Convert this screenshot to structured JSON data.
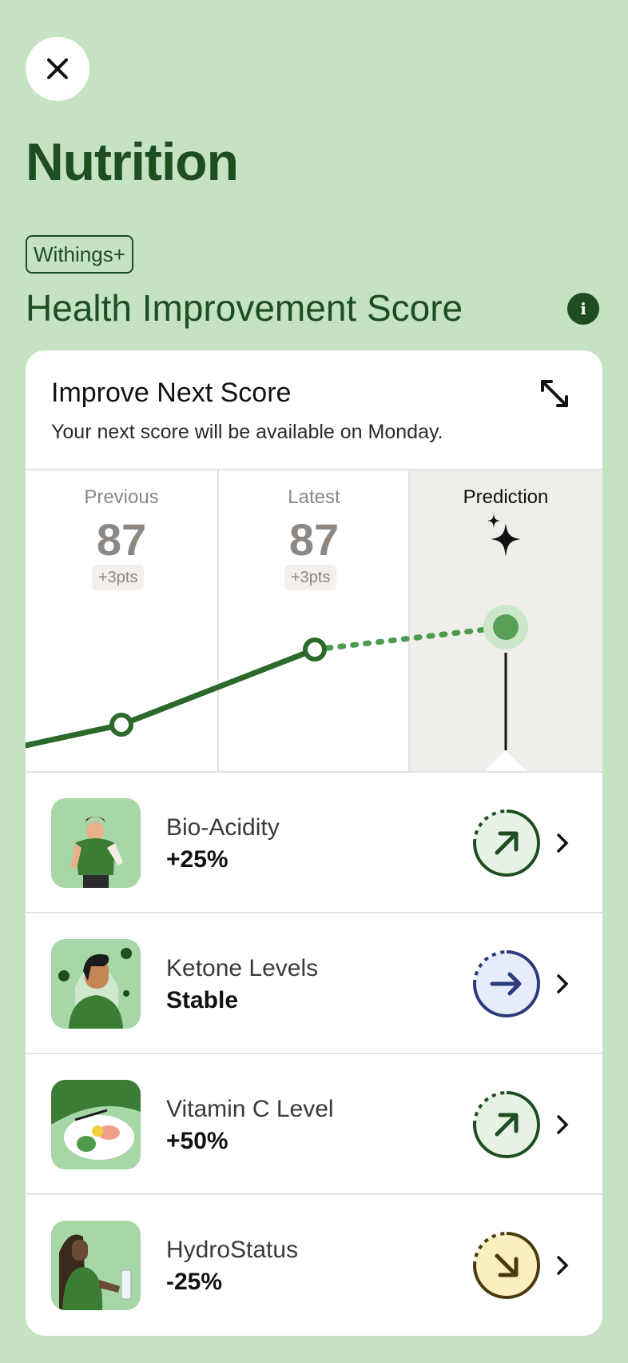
{
  "header": {
    "close_icon": "close-icon",
    "title": "Nutrition",
    "badge": "Withings+",
    "section_title": "Health Improvement Score",
    "info_icon_glyph": "i"
  },
  "card": {
    "title": "Improve Next Score",
    "subtitle": "Your next score will be available on Monday.",
    "expand_icon": "expand-icon"
  },
  "score_columns": {
    "previous": {
      "label": "Previous",
      "value": "87",
      "delta": "+3pts"
    },
    "latest": {
      "label": "Latest",
      "value": "87",
      "delta": "+3pts"
    },
    "prediction": {
      "label": "Prediction",
      "icon": "sparkle-icon"
    }
  },
  "metrics": [
    {
      "name": "Bio-Acidity",
      "value": "+25%",
      "trend": "up",
      "color": "#1f4d22",
      "fill": "#e6f3e4"
    },
    {
      "name": "Ketone Levels",
      "value": "Stable",
      "trend": "flat",
      "color": "#2d3a7c",
      "fill": "#e6ecfa"
    },
    {
      "name": "Vitamin C Level",
      "value": "+50%",
      "trend": "up",
      "color": "#1f4d22",
      "fill": "#e6f3e4"
    },
    {
      "name": "HydroStatus",
      "value": "-25%",
      "trend": "down",
      "color": "#4a3a0e",
      "fill": "#fbefbf"
    }
  ],
  "colors": {
    "background": "#c5e2c2",
    "brand_dark": "#1f4d22",
    "line": "#2c6a2c",
    "prediction_bg": "#f0eeeb"
  }
}
